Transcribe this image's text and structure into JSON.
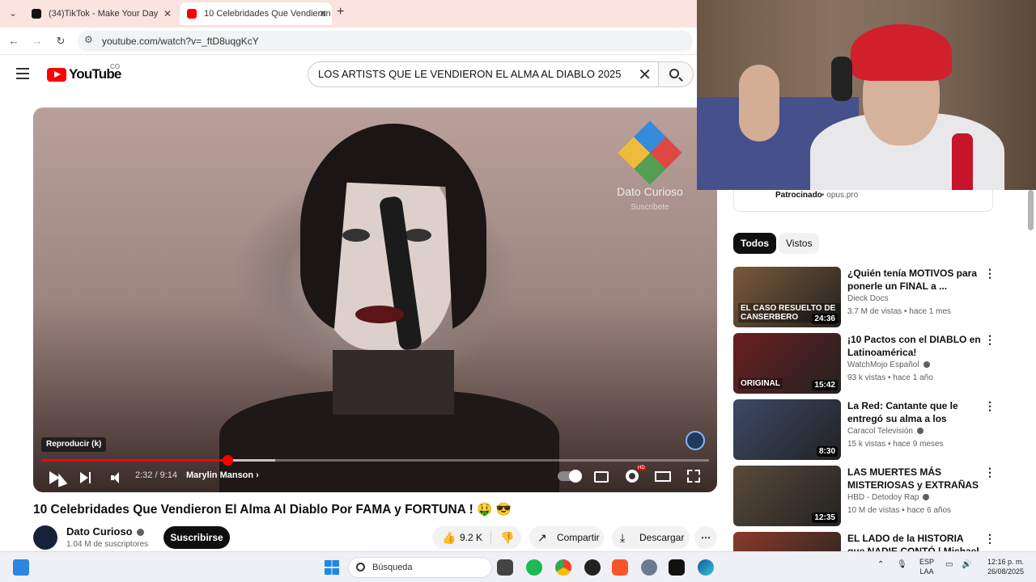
{
  "browser": {
    "tabs": [
      {
        "label": "(34)TikTok - Make Your Day",
        "active": false
      },
      {
        "label": "10 Celebridades Que Vendieron",
        "active": true
      }
    ],
    "url": "youtube.com/watch?v=_ftD8uqgKcY"
  },
  "youtube": {
    "logo_text": "YouTube",
    "country_code": "CO",
    "search_query": "LOS ARTISTS QUE LE VENDIERON EL ALMA AL DIABLO 2025"
  },
  "player": {
    "watermark_name": "Dato Curioso",
    "watermark_sub": "Suscribete",
    "tooltip": "Reproducir (k)",
    "time": "2:32 / 9:14",
    "chapter": "Marylin Manson",
    "progress_fraction": 0.279,
    "buffered_fraction": 0.35,
    "hd_badge": "HD"
  },
  "video": {
    "title": "10 Celebridades Que Vendieron El Alma Al Diablo Por FAMA y FORTUNA ! 🤑 😎",
    "channel": "Dato Curioso",
    "subscribers": "1.04 M de suscriptores",
    "subscribe_label": "Suscribirse",
    "likes": "9.2 K",
    "share_label": "Compartir",
    "download_label": "Descargar"
  },
  "sidebar": {
    "ad": {
      "sponsored": "Patrocinado",
      "domain": "opus.pro"
    },
    "chips": [
      "Todos",
      "Vistos"
    ],
    "recommendations": [
      {
        "title": "¿Quién tenía MOTIVOS para ponerle un FINAL a ...",
        "channel": "Dieck Docs",
        "verified": false,
        "meta": "3.7 M de vistas • hace 1 mes",
        "duration": "24:36",
        "thumb_text": "EL CASO RESUELTO DE CANSERBERO",
        "color": "#7a5a3a"
      },
      {
        "title": "¡10 Pactos con el DIABLO en Latinoamérica!",
        "channel": "WatchMojo Español",
        "verified": true,
        "meta": "93 k vistas • hace 1 año",
        "duration": "15:42",
        "thumb_text": "ORIGINAL",
        "color": "#6b1f1f"
      },
      {
        "title": "La Red: Cantante que le entregó su alma a los Illuminati para s...",
        "channel": "Caracol Televisión",
        "verified": true,
        "meta": "15 k vistas • hace 9 meses",
        "duration": "8:30",
        "thumb_text": "",
        "color": "#3c4a66"
      },
      {
        "title": "LAS MUERTES MÁS MISTERIOSAS y EXTRAÑAS D...",
        "channel": "HBD - Detodoy Rap",
        "verified": true,
        "meta": "10 M de vistas • hace 6 años",
        "duration": "12:35",
        "thumb_text": "",
        "color": "#5a4a3a"
      },
      {
        "title": "EL LADO de la HISTORIA que NADIE CONTÓ | Michael",
        "channel": "",
        "verified": false,
        "meta": "",
        "duration": "",
        "thumb_text": "",
        "color": "#8a3a2a"
      }
    ]
  },
  "taskbar": {
    "search_placeholder": "Búsqueda",
    "lang_line1": "ESP",
    "lang_line2": "LAA",
    "time": "12:16 p. m.",
    "date": "26/08/2025"
  },
  "colors": {
    "accent": "#ff0000",
    "tab_bar": "#fbe3e0"
  }
}
